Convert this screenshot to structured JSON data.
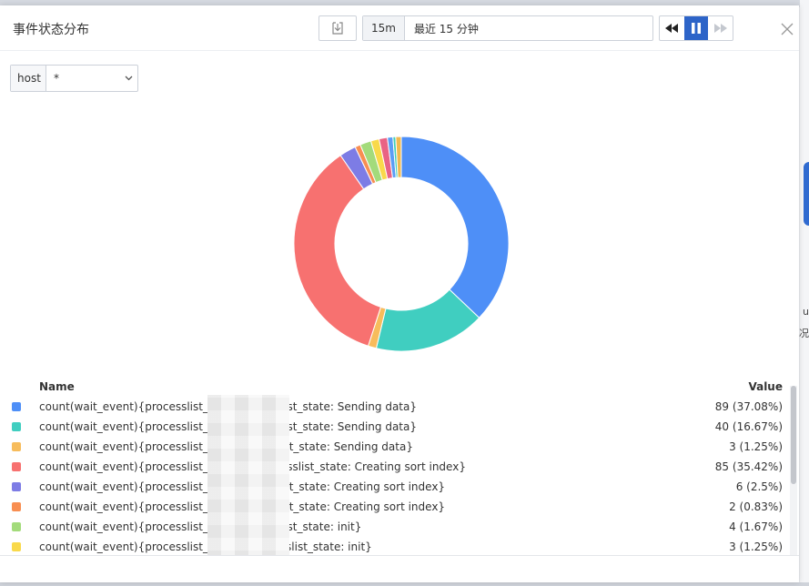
{
  "dialog": {
    "title": "事件状态分布"
  },
  "toolbar": {
    "download_icon": "download-icon",
    "time_range_tag": "15m",
    "time_range_text": "最近 15 分钟",
    "rewind_icon": "rewind-icon",
    "pause_icon": "pause-icon",
    "forward_icon": "fast-forward-icon",
    "close_icon": "close-icon",
    "accent_color": "#2d64c8"
  },
  "filter": {
    "label": "host",
    "value": "*"
  },
  "background": {
    "right_chars": [
      "u",
      "况"
    ]
  },
  "chart_data": {
    "type": "pie",
    "donut": true,
    "slices": [
      {
        "value": 89,
        "color": "#4e8ff7"
      },
      {
        "value": 40,
        "color": "#40cec0"
      },
      {
        "value": 3,
        "color": "#f7bc5c"
      },
      {
        "value": 85,
        "color": "#f77170"
      },
      {
        "value": 6,
        "color": "#7d7ce5"
      },
      {
        "value": 2,
        "color": "#f88e51"
      },
      {
        "value": 4,
        "color": "#a3db7b"
      },
      {
        "value": 3,
        "color": "#f9d94b"
      },
      {
        "value": 3,
        "color": "#e96384"
      },
      {
        "value": 2,
        "color": "#5b9df5"
      },
      {
        "value": 1,
        "color": "#3ecfb8"
      },
      {
        "value": 2,
        "color": "#f0b94f"
      }
    ]
  },
  "legend": {
    "name_header": "Name",
    "value_header": "Value",
    "rows": [
      {
        "name": "count(wait_event){processlist_host: processlist_state: Sending data}",
        "value": "89 (37.08%)",
        "color": "#4e8ff7"
      },
      {
        "name": "count(wait_event){processlist_host: processlist_state: Sending data}",
        "value": "40 (16.67%)",
        "color": "#40cec0"
      },
      {
        "name": "count(wait_event){processlist_host processlist_state: Sending data}",
        "value": "3 (1.25%)",
        "color": "#f7bc5c"
      },
      {
        "name": "count(wait_event){processlist_host 44, processlist_state: Creating sort index}",
        "value": "85 (35.42%)",
        "color": "#f77170"
      },
      {
        "name": "count(wait_event){processlist_host processlist_state: Creating sort index}",
        "value": "6 (2.5%)",
        "color": "#7d7ce5"
      },
      {
        "name": "count(wait_event){processlist_host processlist_state: Creating sort index}",
        "value": "2 (0.83%)",
        "color": "#f88e51"
      },
      {
        "name": "count(wait_event){processlist_host: processlist_state: init}",
        "value": "4 (1.67%)",
        "color": "#a3db7b"
      },
      {
        "name": "count(wait_event){processlist_host: 1 processlist_state: init}",
        "value": "3 (1.25%)",
        "color": "#f9d94b"
      }
    ]
  }
}
